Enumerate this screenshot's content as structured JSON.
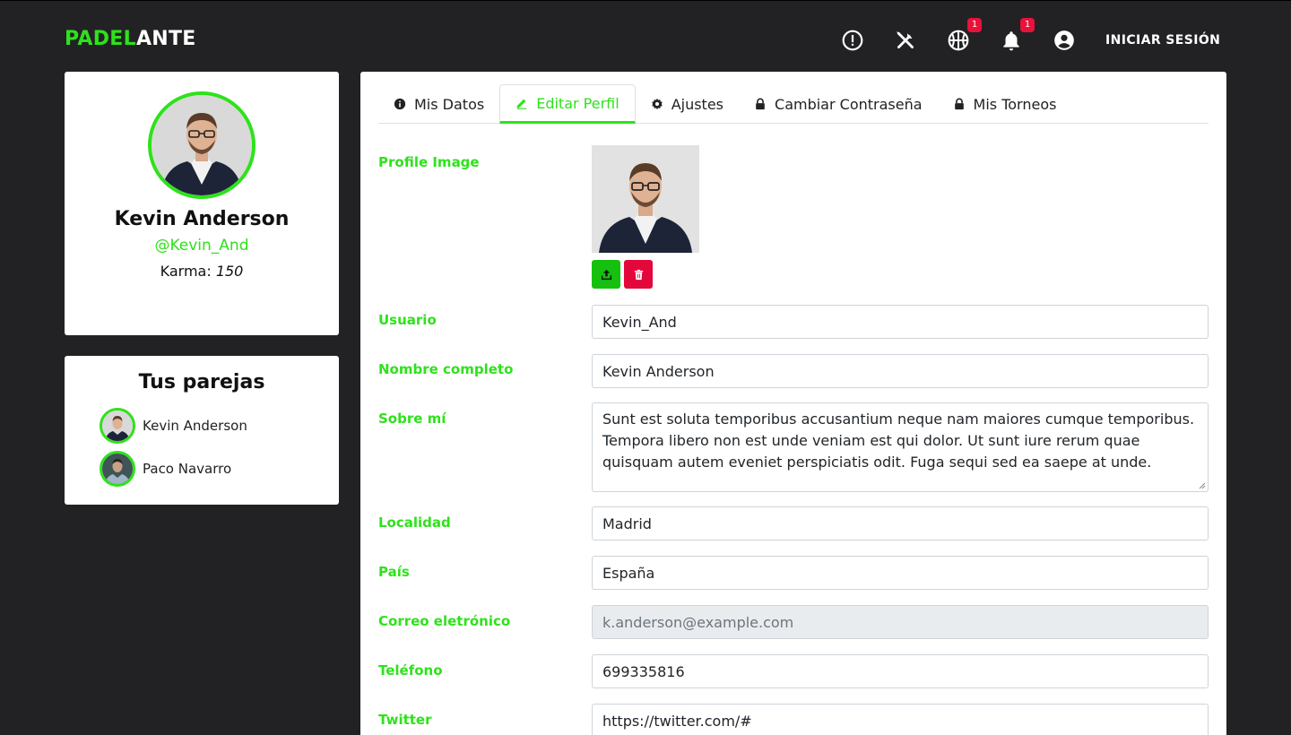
{
  "brand": {
    "part1": "PADEL",
    "part2": "ANTE"
  },
  "header": {
    "icons": [
      {
        "name": "alert-circle-icon"
      },
      {
        "name": "tools-icon"
      },
      {
        "name": "basketball-icon",
        "badge": "1"
      },
      {
        "name": "bell-icon",
        "badge": "1"
      },
      {
        "name": "account-circle-icon"
      }
    ],
    "login_label": "INICIAR SESIÓN"
  },
  "profile": {
    "name": "Kevin Anderson",
    "handle": "@Kevin_And",
    "karma_label": "Karma:",
    "karma_value": "150"
  },
  "partners": {
    "title": "Tus parejas",
    "items": [
      {
        "name": "Kevin Anderson"
      },
      {
        "name": "Paco Navarro"
      }
    ]
  },
  "tabs": [
    {
      "label": "Mis Datos",
      "icon": "info-icon"
    },
    {
      "label": "Editar Perfil",
      "icon": "pencil-icon",
      "active": true
    },
    {
      "label": "Ajustes",
      "icon": "gear-icon"
    },
    {
      "label": "Cambiar Contraseña",
      "icon": "lock-icon"
    },
    {
      "label": "Mis Torneos",
      "icon": "lock-icon"
    }
  ],
  "form": {
    "profile_image_label": "Profile Image",
    "usuario_label": "Usuario",
    "usuario_value": "Kevin_And",
    "nombre_label": "Nombre completo",
    "nombre_value": "Kevin Anderson",
    "sobre_label": "Sobre mí",
    "sobre_value": "Sunt est soluta temporibus accusantium neque nam maiores cumque temporibus. Tempora libero non est unde veniam est qui dolor. Ut sunt iure rerum quae quisquam autem eveniet perspiciatis odit. Fuga sequi sed ea saepe at unde.",
    "localidad_label": "Localidad",
    "localidad_value": "Madrid",
    "pais_label": "País",
    "pais_value": "España",
    "correo_label": "Correo eletrónico",
    "correo_value": "k.anderson@example.com",
    "telefono_label": "Teléfono",
    "telefono_value": "699335816",
    "twitter_label": "Twitter",
    "twitter_value": "https://twitter.com/#"
  },
  "colors": {
    "accent": "#2ee21b",
    "background": "#222224",
    "badge": "#e8123a",
    "delete": "#e3073c"
  }
}
